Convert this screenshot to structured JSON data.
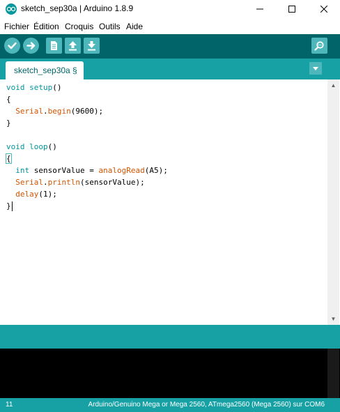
{
  "window": {
    "title": "sketch_sep30a | Arduino 1.8.9"
  },
  "menu": [
    "Fichier",
    "Édition",
    "Croquis",
    "Outils",
    "Aide"
  ],
  "toolbar": {
    "buttons": [
      "verify-icon",
      "upload-icon",
      "new-icon",
      "open-icon",
      "save-icon"
    ],
    "serial_monitor": "serial-monitor-icon"
  },
  "tabs": [
    {
      "label": "sketch_sep30a §"
    }
  ],
  "code": {
    "l1": {
      "kw": "void",
      "name": " setup",
      "rest": "()"
    },
    "l2": "{",
    "l3": {
      "fn": "Serial",
      "dot": ".",
      "fn2": "begin",
      "rest": "(9600);"
    },
    "l4": "}",
    "l6": {
      "kw": "void",
      "name": " loop",
      "rest": "()"
    },
    "l7": "{",
    "l8": {
      "kw": "int",
      "mid": " sensorValue = ",
      "fn": "analogRead",
      "rest": "(A5);"
    },
    "l9": {
      "fn": "Serial",
      "dot": ".",
      "fn2": "println",
      "rest": "(sensorValue);"
    },
    "l10": {
      "fn": "delay",
      "rest": "(1);"
    },
    "l11": "}"
  },
  "status": {
    "line": "11",
    "board": "Arduino/Genuino Mega or Mega 2560, ATmega2560 (Mega 2560) sur COM6"
  },
  "colors": {
    "toolbar": "#006468",
    "tabbar": "#17a1a5",
    "keyword": "#00979c",
    "function": "#d35400"
  }
}
